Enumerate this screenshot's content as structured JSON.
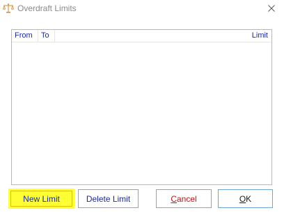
{
  "window": {
    "title": "Overdraft Limits",
    "app_icon": "scales-icon",
    "close_icon": "close-icon"
  },
  "list": {
    "columns": [
      "From",
      "To",
      "Limit"
    ],
    "rows": []
  },
  "buttons": {
    "new_limit": "New Limit",
    "delete_limit": "Delete Limit",
    "cancel_first": "C",
    "cancel_rest": "ancel",
    "ok_first": "O",
    "ok_rest": "K"
  },
  "colors": {
    "link_text": "#1a2aa0",
    "cancel_text": "#c0141c",
    "highlight": "#ffff33"
  }
}
